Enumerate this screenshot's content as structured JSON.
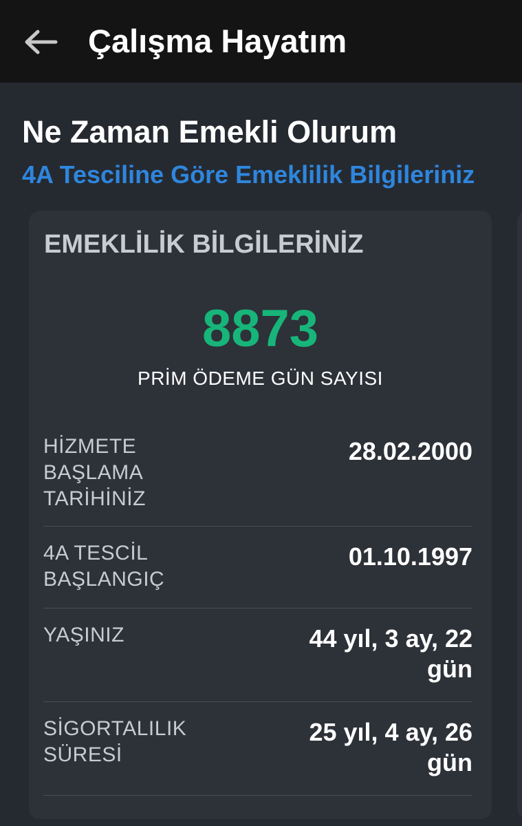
{
  "header": {
    "title": "Çalışma Hayatım",
    "back_icon": "arrow-left-icon"
  },
  "page": {
    "heading": "Ne Zaman Emekli Olurum",
    "subheading": "4A Tesciline Göre Emeklilik Bilgileriniz"
  },
  "card": {
    "title": "EMEKLİLİK BİLGİLERİNİZ",
    "prim_days": "8873",
    "prim_days_label": "PRİM ÖDEME GÜN SAYISI",
    "rows": [
      {
        "label": "HİZMETE BAŞLAMA TARİHİNİZ",
        "value": "28.02.2000"
      },
      {
        "label": "4A TESCİL BAŞLANGIÇ",
        "value": "01.10.1997"
      },
      {
        "label": "YAŞINIZ",
        "value": "44 yıl, 3 ay, 22 gün"
      },
      {
        "label": "SİGORTALILIK SÜRESİ",
        "value": "25 yıl, 4 ay, 26 gün"
      }
    ]
  },
  "colors": {
    "background": "#252a31",
    "topbar": "#141414",
    "card": "#2d3138",
    "accent_blue": "#2f86dd",
    "accent_green": "#17b57a"
  }
}
